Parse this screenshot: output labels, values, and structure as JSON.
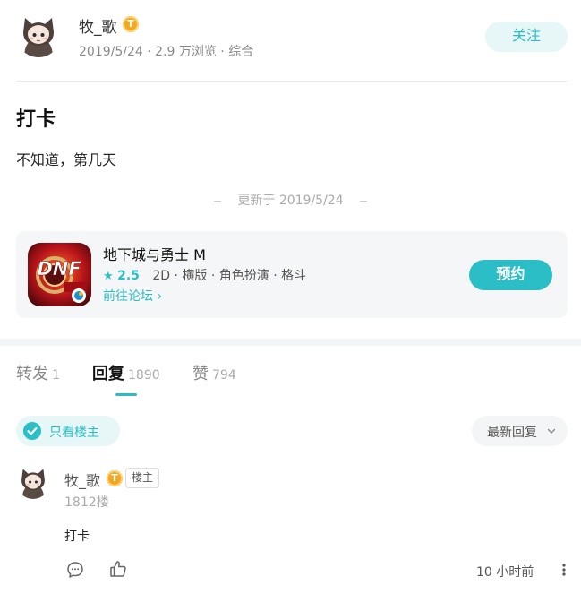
{
  "post": {
    "author": "牧_歌",
    "level_badge": "T",
    "meta": "2019/5/24 · 2.9 万浏览 · 综合",
    "follow_label": "关注",
    "title": "打卡",
    "body": "不知道，第几天",
    "updated": "更新于 2019/5/24"
  },
  "game": {
    "name": "地下城与勇士 M",
    "score": "2.5",
    "tags": "2D · 横版 · 角色扮演 · 格斗",
    "forum_link": "前往论坛 ›",
    "reserve_label": "预约"
  },
  "tabs": [
    {
      "label": "转发",
      "count": "1"
    },
    {
      "label": "回复",
      "count": "1890",
      "active": true
    },
    {
      "label": "赞",
      "count": "794"
    }
  ],
  "filters": {
    "op_only": "只看楼主",
    "sort": "最新回复"
  },
  "reply": {
    "author": "牧_歌",
    "level_badge": "T",
    "op_tag": "楼主",
    "floor": "1812楼",
    "body": "打卡",
    "time": "10 小时前"
  },
  "icons": {
    "verified": "check-icon",
    "sort": "chevron-down-icon",
    "comment": "comment-icon",
    "like": "thumbs-up-icon",
    "more": "more-vertical-icon",
    "star": "star-icon"
  },
  "colors": {
    "accent": "#2bbec7",
    "accent_soft": "#e7f6f6",
    "badge": "#f5a623"
  }
}
